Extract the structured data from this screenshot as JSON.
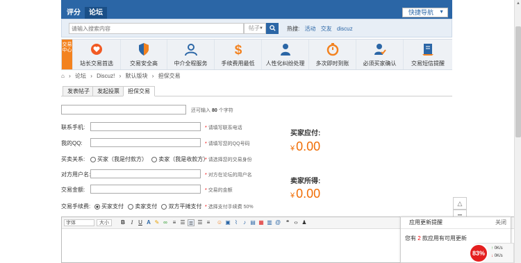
{
  "nav": {
    "tabs": [
      "评分",
      "论坛"
    ],
    "quick_nav": "快捷导航"
  },
  "search": {
    "placeholder": "请输入搜索内容",
    "scope": "帖子",
    "hot_label": "热搜:",
    "hot_links": [
      "活动",
      "交友",
      "discuz"
    ]
  },
  "features": {
    "badge": "交易中心",
    "items": [
      {
        "label": "站长交易首选",
        "icon": "heart-badge-icon"
      },
      {
        "label": "交易安全高",
        "icon": "shield-icon"
      },
      {
        "label": "中介全程服务",
        "icon": "user-outline-icon"
      },
      {
        "label": "手续费用最低",
        "icon": "dollar-icon"
      },
      {
        "label": "人性化纠纷处理",
        "icon": "person-icon"
      },
      {
        "label": "多次即时到账",
        "icon": "stopwatch-icon"
      },
      {
        "label": "必须买家确认",
        "icon": "user-check-icon"
      },
      {
        "label": "交易短信提醒",
        "icon": "note-icon"
      }
    ]
  },
  "breadcrumb": [
    "论坛",
    "Discuz!",
    "默认版块",
    "担保交易"
  ],
  "tabs": [
    "发表帖子",
    "发起投票",
    "担保交易"
  ],
  "subject_hint": {
    "prefix": "还可输入",
    "count": "80",
    "suffix": "个字符"
  },
  "form": {
    "phone": {
      "label": "联系手机:",
      "hint": "请填写联系电话"
    },
    "qq": {
      "label": "我的QQ:",
      "hint": "请填写您的QQ号码"
    },
    "relation": {
      "label": "买卖关系:",
      "options": [
        "买家（我是付款方）",
        "卖家（我是收款方）"
      ],
      "hint": "请选择您的交易身份"
    },
    "other_user": {
      "label": "对方用户名:",
      "hint": "对方在论坛的用户名"
    },
    "amount": {
      "label": "交易金额:",
      "hint": "交易的金额"
    },
    "fee": {
      "label": "交易手续费:",
      "options": [
        "买家支付",
        "卖家支付",
        "双方平摊支付"
      ],
      "hint": "选择支付手续费 50%"
    }
  },
  "buyer": {
    "label": "买家应付:",
    "currency": "¥",
    "value": "0.00"
  },
  "seller": {
    "label": "卖家所得:",
    "currency": "¥",
    "value": "0.00"
  },
  "editor": {
    "font_label": "字体",
    "size_label": "大小"
  },
  "notify": {
    "title": "应用更新提醒",
    "close": "关闭",
    "body_prefix": "您有",
    "count": "2",
    "body_suffix": "款应用有可用更新"
  },
  "speed": {
    "percent": "83%",
    "up": "0K/s",
    "down": "0K/s"
  },
  "colors": {
    "brand": "#2b66a6",
    "accent": "#f06d05",
    "badge": "#f3821f"
  }
}
